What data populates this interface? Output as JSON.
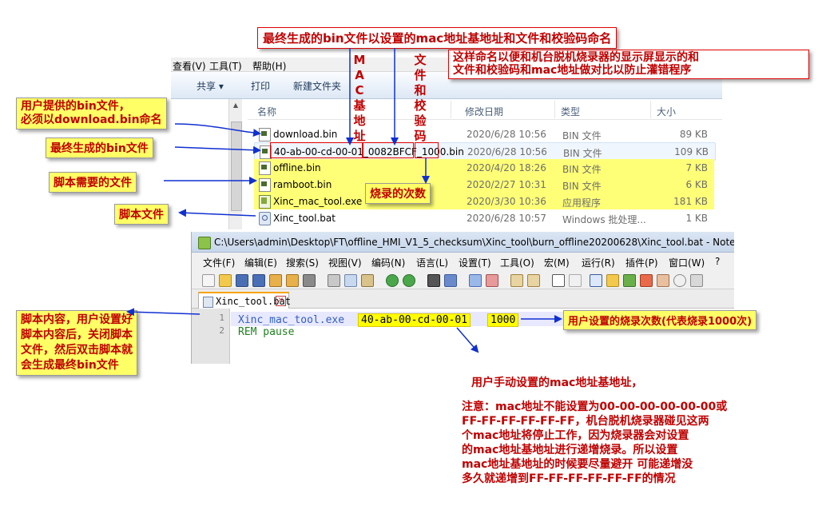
{
  "explorer": {
    "menu": [
      "查看(V)",
      "工具(T)",
      "帮助(H)"
    ],
    "toolbar": [
      "共享 ▾",
      "打印",
      "新建文件夹"
    ],
    "columns": [
      "名称",
      "修改日期",
      "类型",
      "大小"
    ],
    "files": [
      {
        "name": "download.bin",
        "date": "2020/6/28 10:56",
        "type": "BIN 文件",
        "size": "89 KB"
      },
      {
        "name": "40-ab-00-cd-00-01_0082BFCF_1000.bin",
        "date": "2020/6/28 10:56",
        "type": "BIN 文件",
        "size": "109 KB"
      },
      {
        "name": "offline.bin",
        "date": "2020/4/20 18:26",
        "type": "BIN 文件",
        "size": "7 KB"
      },
      {
        "name": "ramboot.bin",
        "date": "2020/2/27 10:31",
        "type": "BIN 文件",
        "size": "6 KB"
      },
      {
        "name": "Xinc_mac_tool.exe",
        "date": "2020/3/30 10:36",
        "type": "应用程序",
        "size": "181 KB"
      },
      {
        "name": "Xinc_tool.bat",
        "date": "2020/6/28 10:57",
        "type": "Windows 批处理...",
        "size": "1 KB"
      }
    ],
    "generated_name_parts": {
      "mac": "40-ab-00-cd-00-01",
      "sep1": "_",
      "checksum": "0082BFCF",
      "sep2": "_",
      "count": "1000",
      "ext": ".bin"
    }
  },
  "notepad": {
    "title": "C:\\Users\\admin\\Desktop\\FT\\offline_HMI_V1_5_checksum\\Xinc_tool\\burn_offline20200628\\Xinc_tool.bat - Note",
    "menu": [
      "文件(F)",
      "编辑(E)",
      "搜索(S)",
      "视图(V)",
      "编码(N)",
      "语言(L)",
      "设置(T)",
      "工具(O)",
      "宏(M)",
      "运行(R)",
      "插件(P)",
      "窗口(W)",
      "?"
    ],
    "tab": "Xinc_tool.bat",
    "lines": [
      "1",
      "2"
    ],
    "code": {
      "cmd": "Xinc_mac_tool.exe",
      "mac": "40-ab-00-cd-00-01",
      "count": "1000",
      "line2": "REM pause"
    }
  },
  "annotations": {
    "top_title": "最终生成的bin文件以设置的mac地址基地址和文件和校验码命名",
    "naming_reason_1": "这样命名以便和机台脱机烧录器的显示屏显示的和",
    "naming_reason_2": "文件和校验码和mac地址做对比以防止灌错程序",
    "mac_vertical": "MAC基地址",
    "checksum_vertical": "文件和校验码",
    "download_note_1": "用户提供的bin文件，",
    "download_note_2": "必须以download.bin命名",
    "final_bin": "最终生成的bin文件",
    "script_needed": "脚本需要的文件",
    "burn_count": "烧录的次数",
    "script_file": "脚本文件",
    "script_content": [
      "脚本内容，用户设置好",
      "脚本内容后，关闭脚本",
      "文件，然后双击脚本就",
      "会生成最终bin文件"
    ],
    "user_count": "用户设置的烧录次数(代表烧录1000次)",
    "mac_base_title": "用户手动设置的mac地址基地址，",
    "warning": [
      "注意：mac地址不能设置为00-00-00-00-00-00或",
      "FF-FF-FF-FF-FF-FF，机台脱机烧录器碰见这两",
      "个mac地址将停止工作，因为烧录器会对设置",
      "的mac地址基地址进行递增烧录。所以设置",
      "mac地址基地址的时候要尽量避开 可能递增没",
      "多久就递增到FF-FF-FF-FF-FF-FF的情况"
    ]
  },
  "colors": {
    "annotation_red": "#c00000",
    "highlight_yellow": "#ffff66",
    "arrow_blue": "#1030d0"
  }
}
